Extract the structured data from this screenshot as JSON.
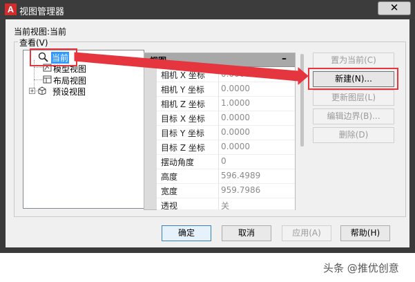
{
  "window": {
    "title": "视图管理器",
    "app_icon_letter": "A",
    "close_glyph": "✕"
  },
  "current_view": {
    "label": "当前视图:",
    "value": "当前"
  },
  "view_group": {
    "label": "查看(V)"
  },
  "tree": {
    "items": [
      {
        "label": "当前",
        "selected": true,
        "icon": "magnifier-icon"
      },
      {
        "label": "模型视图",
        "icon": "model-view-icon"
      },
      {
        "label": "布局视图",
        "icon": "layout-view-icon"
      },
      {
        "label": "预设视图",
        "icon": "preset-view-icon",
        "expander": "+"
      }
    ]
  },
  "properties": {
    "header": "视图",
    "collapse_glyph": "–",
    "rows": [
      {
        "key": "相机 X 坐标",
        "value": "0.0000"
      },
      {
        "key": "相机 Y 坐标",
        "value": "0.0000"
      },
      {
        "key": "相机 Z 坐标",
        "value": "1.0000"
      },
      {
        "key": "目标 X 坐标",
        "value": "0.0000"
      },
      {
        "key": "目标 Y 坐标",
        "value": "0.0000"
      },
      {
        "key": "目标 Z 坐标",
        "value": "0.0000"
      },
      {
        "key": "摆动角度",
        "value": "0"
      },
      {
        "key": "高度",
        "value": "596.4989"
      },
      {
        "key": "宽度",
        "value": "959.7986"
      },
      {
        "key": "透视",
        "value": "关"
      }
    ]
  },
  "side_buttons": {
    "set_current": "置为当前(C)",
    "new": "新建(N)...",
    "update_layers": "更新图层(L)",
    "edit_boundaries": "编辑边界(B)...",
    "delete": "删除(D)"
  },
  "footer_buttons": {
    "ok": "确定",
    "cancel": "取消",
    "apply": "应用(A)",
    "help": "帮助(H)"
  },
  "annotation_color": "#e5353e",
  "watermark": "头条 @推优创意"
}
